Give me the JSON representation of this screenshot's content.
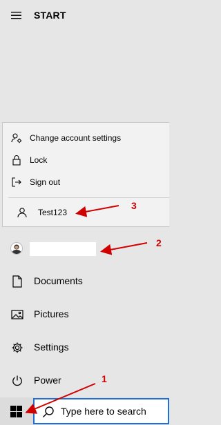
{
  "header": {
    "title": "START",
    "menu_icon": "hamburger-icon"
  },
  "account_menu": {
    "items": [
      {
        "label": "Change account settings",
        "icon": "account-settings-icon"
      },
      {
        "label": "Lock",
        "icon": "lock-icon"
      },
      {
        "label": "Sign out",
        "icon": "sign-out-icon"
      }
    ],
    "user": {
      "label": "Test123",
      "icon": "person-icon"
    }
  },
  "left_menu": {
    "user": {
      "name": "",
      "icon": "avatar-icon"
    },
    "items": [
      {
        "label": "Documents",
        "icon": "document-icon"
      },
      {
        "label": "Pictures",
        "icon": "picture-icon"
      },
      {
        "label": "Settings",
        "icon": "gear-icon"
      },
      {
        "label": "Power",
        "icon": "power-icon"
      }
    ]
  },
  "taskbar": {
    "start_icon": "windows-logo-icon",
    "search": {
      "placeholder": "Type here to search",
      "icon": "search-icon"
    }
  },
  "annotations": {
    "labels": [
      "1",
      "2",
      "3"
    ],
    "color": "#d10000"
  },
  "colors": {
    "accent": "#1f6fd6",
    "background": "#e6e6e6",
    "popup": "#f2f2f2"
  }
}
